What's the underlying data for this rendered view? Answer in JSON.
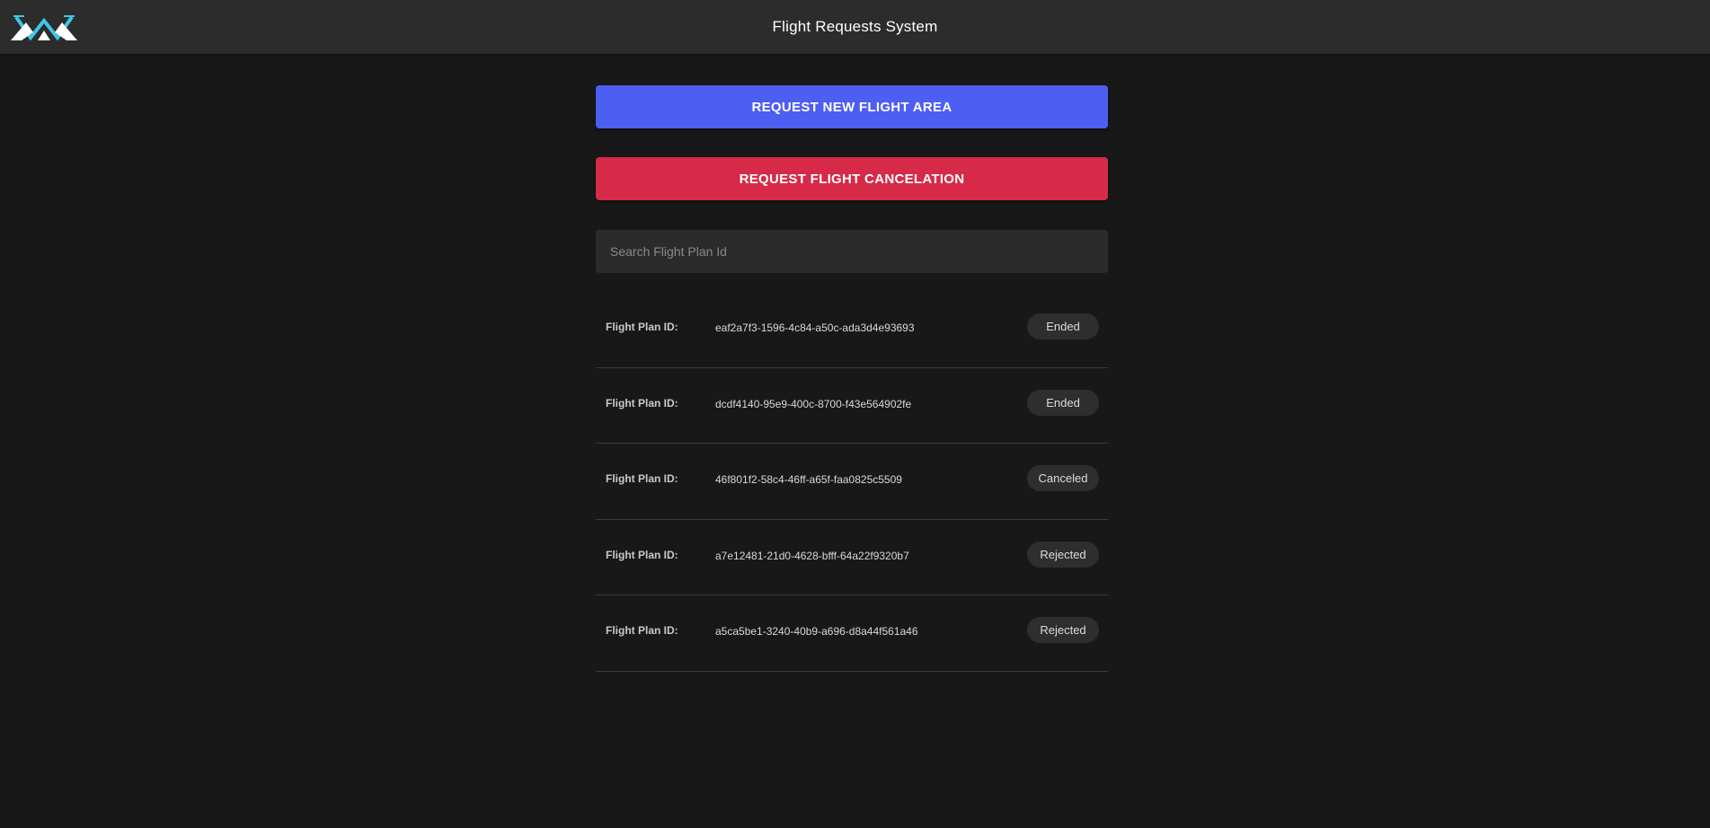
{
  "header": {
    "title": "Flight Requests System",
    "logo_icon": "drone-mountain-logo-icon"
  },
  "actions": {
    "request_new_label": "REQUEST NEW FLIGHT AREA",
    "request_cancel_label": "REQUEST FLIGHT CANCELATION"
  },
  "search": {
    "placeholder": "Search Flight Plan Id",
    "value": ""
  },
  "flight_plans": [
    {
      "label": "Flight Plan ID:",
      "id": "eaf2a7f3-1596-4c84-a50c-ada3d4e93693",
      "status": "Ended"
    },
    {
      "label": "Flight Plan ID:",
      "id": "dcdf4140-95e9-400c-8700-f43e564902fe",
      "status": "Ended"
    },
    {
      "label": "Flight Plan ID:",
      "id": "46f801f2-58c4-46ff-a65f-faa0825c5509",
      "status": "Canceled"
    },
    {
      "label": "Flight Plan ID:",
      "id": "a7e12481-21d0-4628-bfff-64a22f9320b7",
      "status": "Rejected"
    },
    {
      "label": "Flight Plan ID:",
      "id": "a5ca5be1-3240-40b9-a696-d8a44f561a46",
      "status": "Rejected"
    }
  ],
  "colors": {
    "request_new": "#4d5ef2",
    "request_cancel": "#d62a48",
    "logo_accent": "#3ec6e8",
    "logo_white": "#ffffff"
  }
}
